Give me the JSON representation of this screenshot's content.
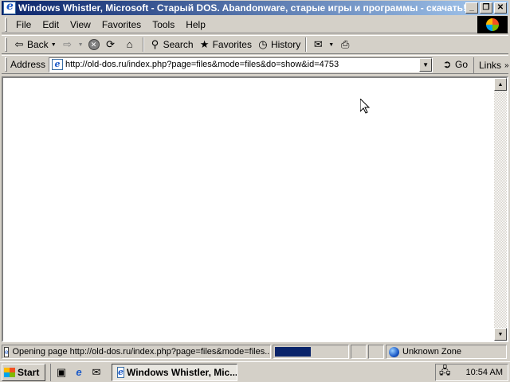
{
  "window": {
    "title": "Windows Whistler, Microsoft - Старый DOS. Abandonware, старые игры и программы - скачать! - ...",
    "minimize": "_",
    "maximize": "❐",
    "close": "✕"
  },
  "menu": [
    "File",
    "Edit",
    "View",
    "Favorites",
    "Tools",
    "Help"
  ],
  "toolbar": {
    "back": "Back",
    "search": "Search",
    "favorites": "Favorites",
    "history": "History"
  },
  "address": {
    "label": "Address",
    "url": "http://old-dos.ru/index.php?page=files&mode=files&do=show&id=4753",
    "go": "Go",
    "links": "Links"
  },
  "status": {
    "text": "Opening page http://old-dos.ru/index.php?page=files&mode=files...",
    "progress": 0.5,
    "zone": "Unknown Zone"
  },
  "taskbar": {
    "start": "Start",
    "task": "Windows Whistler, Mic...",
    "clock": "10:54 AM"
  },
  "colors": {
    "titlebar_start": "#0a246a",
    "titlebar_end": "#a6caf0",
    "progress": "#0a246a",
    "chrome": "#d4d0c8"
  }
}
